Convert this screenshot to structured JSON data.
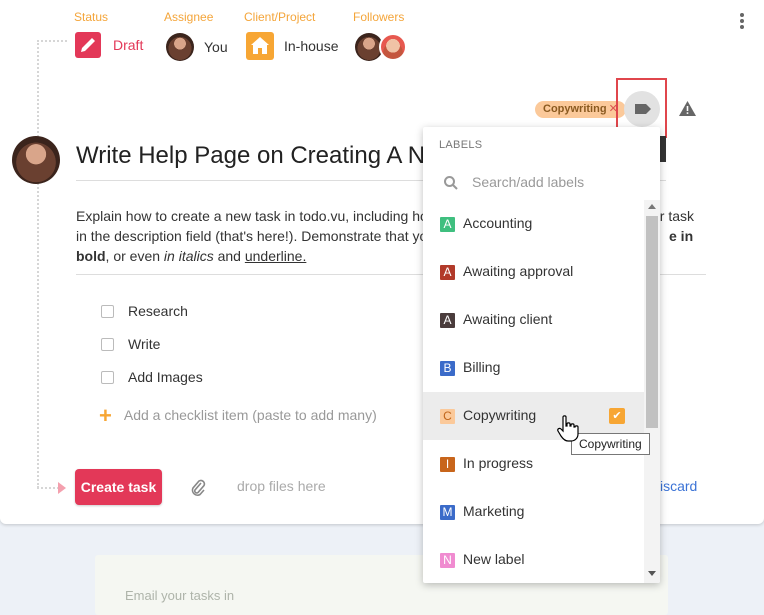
{
  "header": {
    "status": {
      "label": "Status",
      "value": "Draft",
      "color": "#e33858"
    },
    "assignee": {
      "label": "Assignee",
      "value": "You"
    },
    "client_project": {
      "label": "Client/Project",
      "value": "In-house"
    },
    "followers": {
      "label": "Followers"
    }
  },
  "tags": {
    "chip_label": "Copywriting",
    "chip_remove": "✕"
  },
  "task": {
    "title": "Write Help Page on Creating A Ne",
    "description": {
      "line1": "Explain how to create a new task in todo.vu, including ho",
      "line1_end": "ur task",
      "line2": "in the description field (that's here!). Demonstrate that yo",
      "line2_end_bold": "e in",
      "line3_bold": "bold",
      "line3_a": ", or even ",
      "line3_italic": "in italics",
      "line3_b": " and ",
      "line3_underline": "underline."
    },
    "checklist": [
      {
        "label": "Research"
      },
      {
        "label": "Write"
      },
      {
        "label": "Add Images"
      }
    ],
    "add_checklist_placeholder": "Add a checklist item (paste to add many)"
  },
  "footer": {
    "create_button": "Create task",
    "drop_files": "drop files here",
    "discard": "iscard"
  },
  "labels_dropdown": {
    "header": "LABELS",
    "search_placeholder": "Search/add labels",
    "items": [
      {
        "letter": "A",
        "name": "Accounting",
        "color": "#3fbf7f",
        "checked": false
      },
      {
        "letter": "A",
        "name": "Awaiting approval",
        "color": "#b23a2a",
        "checked": false
      },
      {
        "letter": "A",
        "name": "Awaiting client",
        "color": "#4a3c3c",
        "checked": false
      },
      {
        "letter": "B",
        "name": "Billing",
        "color": "#3b6bc9",
        "checked": false
      },
      {
        "letter": "C",
        "name": "Copywriting",
        "color": "#fbc99a",
        "checked": true
      },
      {
        "letter": "I",
        "name": "In progress",
        "color": "#c8651b",
        "checked": false
      },
      {
        "letter": "M",
        "name": "Marketing",
        "color": "#3b6bc9",
        "checked": false
      },
      {
        "letter": "N",
        "name": "New label",
        "color": "#f08bd0",
        "checked": false
      }
    ],
    "tooltip": "Copywriting"
  },
  "email_panel": {
    "text": "Email your tasks in"
  },
  "colors": {
    "accent": "#e33858",
    "orange": "#f7a634",
    "link": "#3b73d6"
  }
}
